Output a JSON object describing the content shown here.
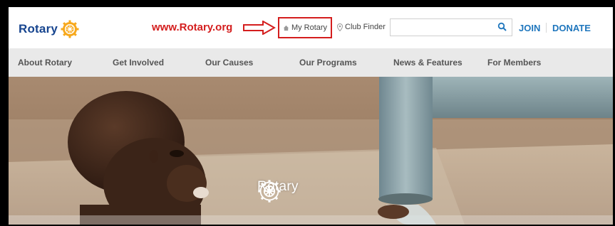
{
  "header": {
    "logo_text": "Rotary",
    "site_url": "www.Rotary.org",
    "my_rotary_label": "My Rotary",
    "club_finder_label": "Club Finder",
    "search_placeholder": "",
    "join_label": "JOIN",
    "donate_label": "DONATE"
  },
  "nav": {
    "items": [
      {
        "label": "About Rotary"
      },
      {
        "label": "Get Involved"
      },
      {
        "label": "Our Causes"
      },
      {
        "label": "Our Programs"
      },
      {
        "label": "News & Features"
      },
      {
        "label": "For Members"
      }
    ]
  },
  "hero": {
    "logo_text": "Rotary"
  },
  "colors": {
    "brand_blue": "#17458f",
    "brand_gold": "#f7a81b",
    "link_blue": "#1e76bd",
    "annotation_red": "#d41e1e",
    "nav_bg": "#e9e9e9"
  },
  "icons": [
    "rotary-wheel-icon",
    "home-icon",
    "location-pin-icon",
    "search-icon",
    "annotation-arrow-icon"
  ]
}
